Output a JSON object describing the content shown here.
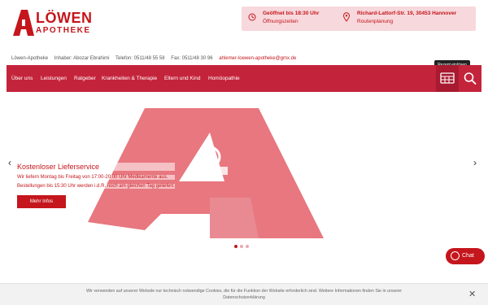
{
  "brand": {
    "name_top": "LÖWEN",
    "name_bottom": "APOTHEKE"
  },
  "info": {
    "hours_title": "Geöffnet bis 18:30 Uhr",
    "hours_sub": "Öffnungszeiten",
    "address_title": "Richard-Lattorf-Str. 19, 30453 Hannover",
    "address_sub": "Routenplanung"
  },
  "contact": {
    "pharmacy": "Löwen-Apotheke",
    "owner": "Inhaber: Abozar Ebrahimi",
    "phone": "Telefon: 0511/48 55 58",
    "fax": "Fax: 0511/48 30 96",
    "email": "ahlemer-loewen-apotheke@gmx.de"
  },
  "nav": {
    "items": [
      "Über uns",
      "Leistungen",
      "Ratgeber",
      "Krankheiten & Therapie",
      "Eltern und Kind",
      "Homöopathie"
    ],
    "tooltip": "Rezept einlösen"
  },
  "slide": {
    "title": "Kostenloser Lieferservice",
    "line1": "Wir liefern Montag bis Freitag von 17:00-20:00 Uhr Medikamente aus.",
    "line2": "Bestellungen bis 15:30 Uhr werden i.d.R. noch am gleichen Tag geliefert.",
    "button": "Mehr Infos"
  },
  "chat": {
    "label": "Chat"
  },
  "cookie": {
    "text": "Wir verwenden auf unserer Website nur technisch notwendige Cookies, die für die Funktion der Website erforderlich sind. Weitere Informationen finden Sie in unserer Datenschutzerklärung"
  },
  "colors": {
    "brand_red": "#c4161c",
    "nav_red": "#c4243b",
    "info_pink": "#f7d8dc"
  }
}
